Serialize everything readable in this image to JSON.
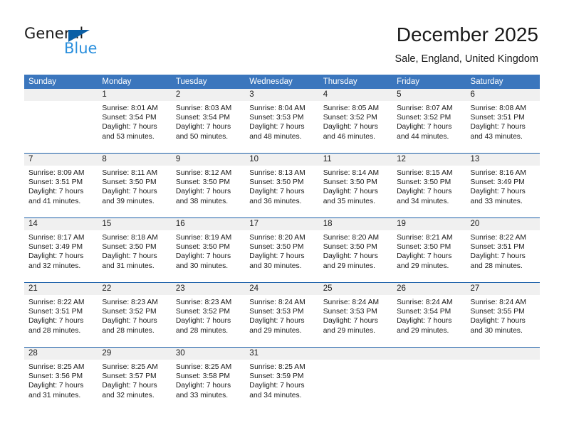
{
  "brand": {
    "name_part1": "General",
    "name_part2": "Blue",
    "logo_icon": "triangle-icon"
  },
  "header": {
    "title": "December 2025",
    "subtitle": "Sale, England, United Kingdom"
  },
  "weekdays": [
    "Sunday",
    "Monday",
    "Tuesday",
    "Wednesday",
    "Thursday",
    "Friday",
    "Saturday"
  ],
  "colors": {
    "header_blue": "#3b76bd",
    "row_divider_blue": "#1a5fa8",
    "day_band_gray": "#f0f0f0",
    "brand_blue": "#2a8fdd",
    "logo_triangle_blue": "#0b5fa5"
  },
  "weeks": [
    [
      {
        "day": "",
        "sunrise": "",
        "sunset": "",
        "daylight_line1": "",
        "daylight_line2": ""
      },
      {
        "day": "1",
        "sunrise": "Sunrise: 8:01 AM",
        "sunset": "Sunset: 3:54 PM",
        "daylight_line1": "Daylight: 7 hours",
        "daylight_line2": "and 53 minutes."
      },
      {
        "day": "2",
        "sunrise": "Sunrise: 8:03 AM",
        "sunset": "Sunset: 3:54 PM",
        "daylight_line1": "Daylight: 7 hours",
        "daylight_line2": "and 50 minutes."
      },
      {
        "day": "3",
        "sunrise": "Sunrise: 8:04 AM",
        "sunset": "Sunset: 3:53 PM",
        "daylight_line1": "Daylight: 7 hours",
        "daylight_line2": "and 48 minutes."
      },
      {
        "day": "4",
        "sunrise": "Sunrise: 8:05 AM",
        "sunset": "Sunset: 3:52 PM",
        "daylight_line1": "Daylight: 7 hours",
        "daylight_line2": "and 46 minutes."
      },
      {
        "day": "5",
        "sunrise": "Sunrise: 8:07 AM",
        "sunset": "Sunset: 3:52 PM",
        "daylight_line1": "Daylight: 7 hours",
        "daylight_line2": "and 44 minutes."
      },
      {
        "day": "6",
        "sunrise": "Sunrise: 8:08 AM",
        "sunset": "Sunset: 3:51 PM",
        "daylight_line1": "Daylight: 7 hours",
        "daylight_line2": "and 43 minutes."
      }
    ],
    [
      {
        "day": "7",
        "sunrise": "Sunrise: 8:09 AM",
        "sunset": "Sunset: 3:51 PM",
        "daylight_line1": "Daylight: 7 hours",
        "daylight_line2": "and 41 minutes."
      },
      {
        "day": "8",
        "sunrise": "Sunrise: 8:11 AM",
        "sunset": "Sunset: 3:50 PM",
        "daylight_line1": "Daylight: 7 hours",
        "daylight_line2": "and 39 minutes."
      },
      {
        "day": "9",
        "sunrise": "Sunrise: 8:12 AM",
        "sunset": "Sunset: 3:50 PM",
        "daylight_line1": "Daylight: 7 hours",
        "daylight_line2": "and 38 minutes."
      },
      {
        "day": "10",
        "sunrise": "Sunrise: 8:13 AM",
        "sunset": "Sunset: 3:50 PM",
        "daylight_line1": "Daylight: 7 hours",
        "daylight_line2": "and 36 minutes."
      },
      {
        "day": "11",
        "sunrise": "Sunrise: 8:14 AM",
        "sunset": "Sunset: 3:50 PM",
        "daylight_line1": "Daylight: 7 hours",
        "daylight_line2": "and 35 minutes."
      },
      {
        "day": "12",
        "sunrise": "Sunrise: 8:15 AM",
        "sunset": "Sunset: 3:50 PM",
        "daylight_line1": "Daylight: 7 hours",
        "daylight_line2": "and 34 minutes."
      },
      {
        "day": "13",
        "sunrise": "Sunrise: 8:16 AM",
        "sunset": "Sunset: 3:49 PM",
        "daylight_line1": "Daylight: 7 hours",
        "daylight_line2": "and 33 minutes."
      }
    ],
    [
      {
        "day": "14",
        "sunrise": "Sunrise: 8:17 AM",
        "sunset": "Sunset: 3:49 PM",
        "daylight_line1": "Daylight: 7 hours",
        "daylight_line2": "and 32 minutes."
      },
      {
        "day": "15",
        "sunrise": "Sunrise: 8:18 AM",
        "sunset": "Sunset: 3:50 PM",
        "daylight_line1": "Daylight: 7 hours",
        "daylight_line2": "and 31 minutes."
      },
      {
        "day": "16",
        "sunrise": "Sunrise: 8:19 AM",
        "sunset": "Sunset: 3:50 PM",
        "daylight_line1": "Daylight: 7 hours",
        "daylight_line2": "and 30 minutes."
      },
      {
        "day": "17",
        "sunrise": "Sunrise: 8:20 AM",
        "sunset": "Sunset: 3:50 PM",
        "daylight_line1": "Daylight: 7 hours",
        "daylight_line2": "and 30 minutes."
      },
      {
        "day": "18",
        "sunrise": "Sunrise: 8:20 AM",
        "sunset": "Sunset: 3:50 PM",
        "daylight_line1": "Daylight: 7 hours",
        "daylight_line2": "and 29 minutes."
      },
      {
        "day": "19",
        "sunrise": "Sunrise: 8:21 AM",
        "sunset": "Sunset: 3:50 PM",
        "daylight_line1": "Daylight: 7 hours",
        "daylight_line2": "and 29 minutes."
      },
      {
        "day": "20",
        "sunrise": "Sunrise: 8:22 AM",
        "sunset": "Sunset: 3:51 PM",
        "daylight_line1": "Daylight: 7 hours",
        "daylight_line2": "and 28 minutes."
      }
    ],
    [
      {
        "day": "21",
        "sunrise": "Sunrise: 8:22 AM",
        "sunset": "Sunset: 3:51 PM",
        "daylight_line1": "Daylight: 7 hours",
        "daylight_line2": "and 28 minutes."
      },
      {
        "day": "22",
        "sunrise": "Sunrise: 8:23 AM",
        "sunset": "Sunset: 3:52 PM",
        "daylight_line1": "Daylight: 7 hours",
        "daylight_line2": "and 28 minutes."
      },
      {
        "day": "23",
        "sunrise": "Sunrise: 8:23 AM",
        "sunset": "Sunset: 3:52 PM",
        "daylight_line1": "Daylight: 7 hours",
        "daylight_line2": "and 28 minutes."
      },
      {
        "day": "24",
        "sunrise": "Sunrise: 8:24 AM",
        "sunset": "Sunset: 3:53 PM",
        "daylight_line1": "Daylight: 7 hours",
        "daylight_line2": "and 29 minutes."
      },
      {
        "day": "25",
        "sunrise": "Sunrise: 8:24 AM",
        "sunset": "Sunset: 3:53 PM",
        "daylight_line1": "Daylight: 7 hours",
        "daylight_line2": "and 29 minutes."
      },
      {
        "day": "26",
        "sunrise": "Sunrise: 8:24 AM",
        "sunset": "Sunset: 3:54 PM",
        "daylight_line1": "Daylight: 7 hours",
        "daylight_line2": "and 29 minutes."
      },
      {
        "day": "27",
        "sunrise": "Sunrise: 8:24 AM",
        "sunset": "Sunset: 3:55 PM",
        "daylight_line1": "Daylight: 7 hours",
        "daylight_line2": "and 30 minutes."
      }
    ],
    [
      {
        "day": "28",
        "sunrise": "Sunrise: 8:25 AM",
        "sunset": "Sunset: 3:56 PM",
        "daylight_line1": "Daylight: 7 hours",
        "daylight_line2": "and 31 minutes."
      },
      {
        "day": "29",
        "sunrise": "Sunrise: 8:25 AM",
        "sunset": "Sunset: 3:57 PM",
        "daylight_line1": "Daylight: 7 hours",
        "daylight_line2": "and 32 minutes."
      },
      {
        "day": "30",
        "sunrise": "Sunrise: 8:25 AM",
        "sunset": "Sunset: 3:58 PM",
        "daylight_line1": "Daylight: 7 hours",
        "daylight_line2": "and 33 minutes."
      },
      {
        "day": "31",
        "sunrise": "Sunrise: 8:25 AM",
        "sunset": "Sunset: 3:59 PM",
        "daylight_line1": "Daylight: 7 hours",
        "daylight_line2": "and 34 minutes."
      },
      {
        "day": "",
        "sunrise": "",
        "sunset": "",
        "daylight_line1": "",
        "daylight_line2": ""
      },
      {
        "day": "",
        "sunrise": "",
        "sunset": "",
        "daylight_line1": "",
        "daylight_line2": ""
      },
      {
        "day": "",
        "sunrise": "",
        "sunset": "",
        "daylight_line1": "",
        "daylight_line2": ""
      }
    ]
  ]
}
